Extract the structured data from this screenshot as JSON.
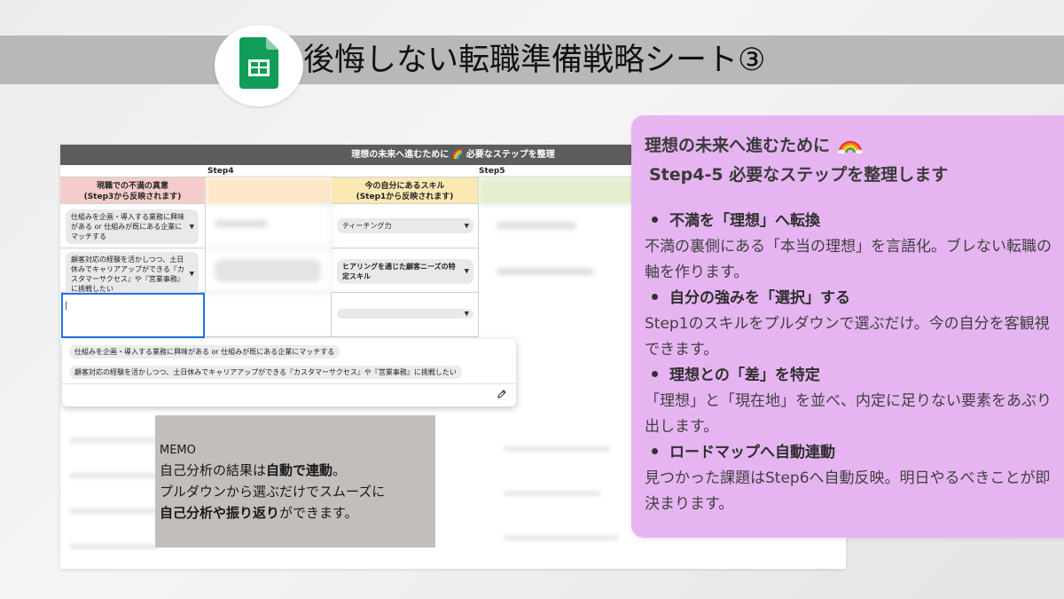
{
  "banner": {
    "title": "後悔しない転職準備戦略シート③",
    "icon": "google-sheets-icon",
    "icon_color": "#0f9d58"
  },
  "sheet": {
    "header": "理想の未来へ進むために 🌈 必要なステップを整理",
    "step4": "Step4",
    "step5": "Step5",
    "col_dissatisfaction": "現職での不満の真意\n(Step3から反映されます)",
    "col_skills": "今の自分にあるスキル\n(Step1から反映されます)",
    "rows": [
      {
        "dissatisfaction": "仕組みを企画・導入する業務に興味がある or 仕組みが既にある企業にマッチする",
        "skill": "ティーチング力"
      },
      {
        "dissatisfaction": "顧客対応の経験を活かしつつ、土日休みでキャリアアップができる『カスタマーサクセス』や『営業事務』に挑戦したい",
        "skill": "ヒアリングを通じた顧客ニーズの特定スキル"
      },
      {
        "dissatisfaction": "|",
        "skill": ""
      }
    ],
    "dropdown_options": [
      "仕組みを企画・導入する業務に興味がある or 仕組みが既にある企業にマッチする",
      "顧客対応の経験を活かしつつ、土日休みでキャリアアップができる『カスタマーサクセス』や『営業事務』に挑戦したい"
    ],
    "colors": {
      "header_bg": "#5d5d5d",
      "dissatisfaction_head": "#f4cccc",
      "skills_head": "#fce8b2",
      "active_border": "#1a73e8"
    }
  },
  "memo": {
    "title": "MEMO",
    "line1_a": "自己分析の結果は",
    "line1_b": "自動で連動",
    "line1_c": "。",
    "line2": "プルダウンから選ぶだけでスムーズに",
    "line3_a": "自己分析や振り返り",
    "line3_b": "ができます。"
  },
  "panel": {
    "heading1": "理想の未来へ進むために",
    "heading2": "Step4-5 必要なステップを整理します",
    "bg_color": "#e6b5f1",
    "bullets": [
      {
        "title": "不満を「理想」へ転換",
        "body": "不満の裏側にある「本当の理想」を言語化。ブレない転職の軸を作ります。"
      },
      {
        "title": "自分の強みを「選択」する",
        "body": "Step1のスキルをプルダウンで選ぶだけ。今の自分を客観視できます。"
      },
      {
        "title": "理想との「差」を特定",
        "body": "「理想」と「現在地」を並べ、内定に足りない要素をあぶり出します。"
      },
      {
        "title": "ロードマップへ自動連動",
        "body": "見つかった課題はStep6へ自動反映。明日やるべきことが即決まります。"
      }
    ]
  }
}
